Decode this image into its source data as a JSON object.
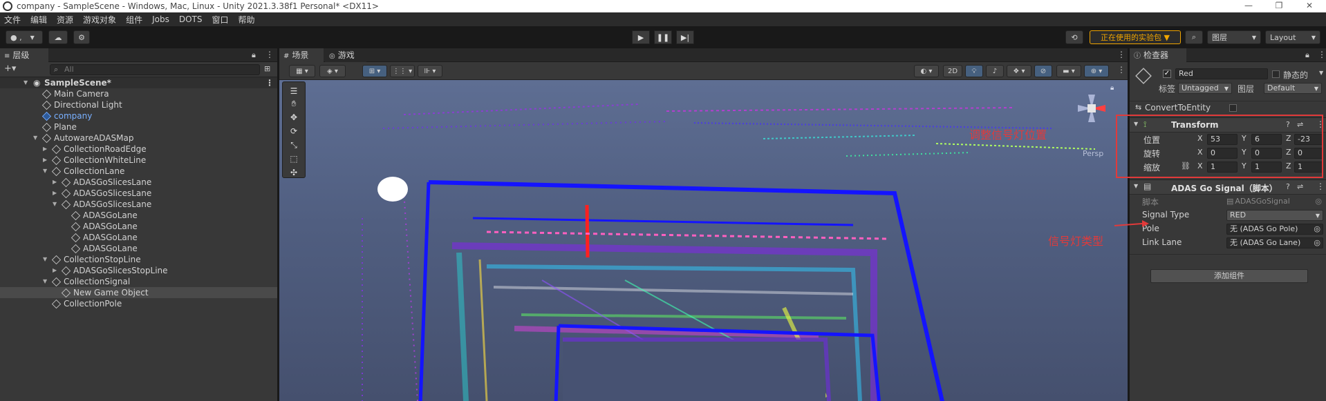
{
  "window": {
    "title": "company - SampleScene - Windows, Mac, Linux - Unity 2021.3.38f1 Personal* <DX11>",
    "controls": [
      "—",
      "❐",
      "✕"
    ]
  },
  "menu": [
    "文件",
    "编辑",
    "资源",
    "游戏对象",
    "组件",
    "Jobs",
    "DOTS",
    "窗口",
    "帮助"
  ],
  "toolbar": {
    "account_label": "●  ,",
    "experimental_label": "正在使用的实验包 ▼",
    "layers_label": "图层",
    "layout_label": "Layout",
    "accent_color": "#f0a500"
  },
  "hierarchy": {
    "tab_label": "层级",
    "add_label": "+▾",
    "search_placeholder": "All",
    "scene_name": "SampleScene*",
    "rows": [
      {
        "label": "Main Camera"
      },
      {
        "label": "Directional Light"
      },
      {
        "label": "company"
      },
      {
        "label": "Plane"
      },
      {
        "label": "AutowareADASMap"
      },
      {
        "label": "CollectionRoadEdge"
      },
      {
        "label": "CollectionWhiteLine"
      },
      {
        "label": "CollectionLane"
      },
      {
        "label": "ADASGoSlicesLane"
      },
      {
        "label": "ADASGoSlicesLane"
      },
      {
        "label": "ADASGoSlicesLane"
      },
      {
        "label": "ADASGoLane"
      },
      {
        "label": "ADASGoLane"
      },
      {
        "label": "ADASGoLane"
      },
      {
        "label": "ADASGoLane"
      },
      {
        "label": "CollectionStopLine"
      },
      {
        "label": "ADASGoSlicesStopLine"
      },
      {
        "label": "CollectionSignal"
      },
      {
        "label": "New Game Object"
      },
      {
        "label": "CollectionPole"
      }
    ]
  },
  "scene": {
    "tab_scene": "场景",
    "tab_game": "游戏",
    "mode_2d": "2D",
    "persp_label": "Persp"
  },
  "inspector": {
    "tab_label": "检查器",
    "object_name": "Red",
    "static_label": "静态的",
    "tag_label": "标签",
    "tag_value": "Untagged",
    "layer_label": "图层",
    "layer_value": "Default",
    "convert_label": "ConvertToEntity",
    "transform": {
      "title": "Transform",
      "position_label": "位置",
      "rotation_label": "旋转",
      "scale_label": "缩放",
      "position": {
        "x": "53",
        "y": "6",
        "z": "-23"
      },
      "rotation": {
        "x": "0",
        "y": "0",
        "z": "0"
      },
      "scale": {
        "x": "1",
        "y": "1",
        "z": "1"
      }
    },
    "script_component": {
      "title": "ADAS Go Signal（脚本）",
      "script_label": "脚本",
      "script_value": "ADASGoSignal",
      "signal_type_label": "Signal Type",
      "signal_type_value": "RED",
      "pole_label": "Pole",
      "pole_value": "无 (ADAS Go Pole)",
      "link_lane_label": "Link Lane",
      "link_lane_value": "无 (ADAS Go Lane)"
    },
    "add_component_label": "添加组件"
  },
  "annotations": {
    "transform_note": "调整信号灯位置",
    "type_note": "信号灯类型",
    "color": "#e23a3a"
  }
}
